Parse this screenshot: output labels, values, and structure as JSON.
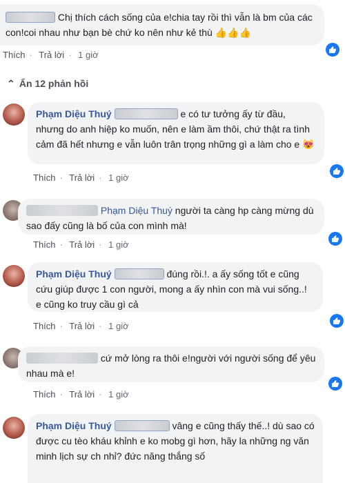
{
  "top_comment": {
    "text": "Chị thích cách sống của e!chia tay rồi thì vẫn là bm của các con!coi nhau như bạn bè chứ ko nên như kẻ thù",
    "emoji": "👍👍👍",
    "actions": {
      "like": "Thích",
      "reply": "Trả lời",
      "time": "1 giờ"
    }
  },
  "replies_toggle": {
    "label": "Ẩn 12 phản hồi"
  },
  "replies": [
    {
      "author": "Phạm Diệu Thuý",
      "text": "e có tư tưởng ấy từ đầu, nhưng do anh hiệp ko muốn, nên e làm ầm thôi, chứ thật ra tình cảm đã hết nhưng e vẫn luôn trân trọng những gì a làm cho e",
      "emoji": "😻",
      "actions": {
        "like": "Thích",
        "reply": "Trả lời",
        "time": "1 giờ"
      }
    },
    {
      "mention": "Phạm Diệu Thuý",
      "text": "người ta càng hp càng mừng dù sao đấy cũng là bố của con mình mà!",
      "actions": {
        "like": "Thích",
        "reply": "Trả lời",
        "time": "1 giờ"
      }
    },
    {
      "author": "Phạm Diệu Thuý",
      "text": "đúng rồi.!. a ấy sống tốt e cũng cứu giúp được 1 con người, mong a ấy nhìn con mà vui sống..! e cũng ko truy cầu gì cả",
      "actions": {
        "like": "Thích",
        "reply": "Trả lời",
        "time": "1 giờ"
      }
    },
    {
      "text": "cứ mở lòng ra thôi e!người với người sống để yêu nhau mà e!",
      "actions": {
        "like": "Thích",
        "reply": "Trả lời",
        "time": "1 giờ"
      }
    },
    {
      "author": "Phạm Diệu Thuý",
      "text": "vâng e cũng thấy thế..! dù sao có được cu tèo kháu khỉnh e ko mobg gì hơn, hãy la những ng văn minh lịch sự ch nhỉ? đức năng thắng số"
    }
  ],
  "colors": {
    "link": "#385898",
    "like_blue": "#1877f2",
    "bubble": "#f2f3f5"
  },
  "icons": {
    "like": "thumbs-up-icon",
    "collapse": "chevron-up-icon"
  }
}
